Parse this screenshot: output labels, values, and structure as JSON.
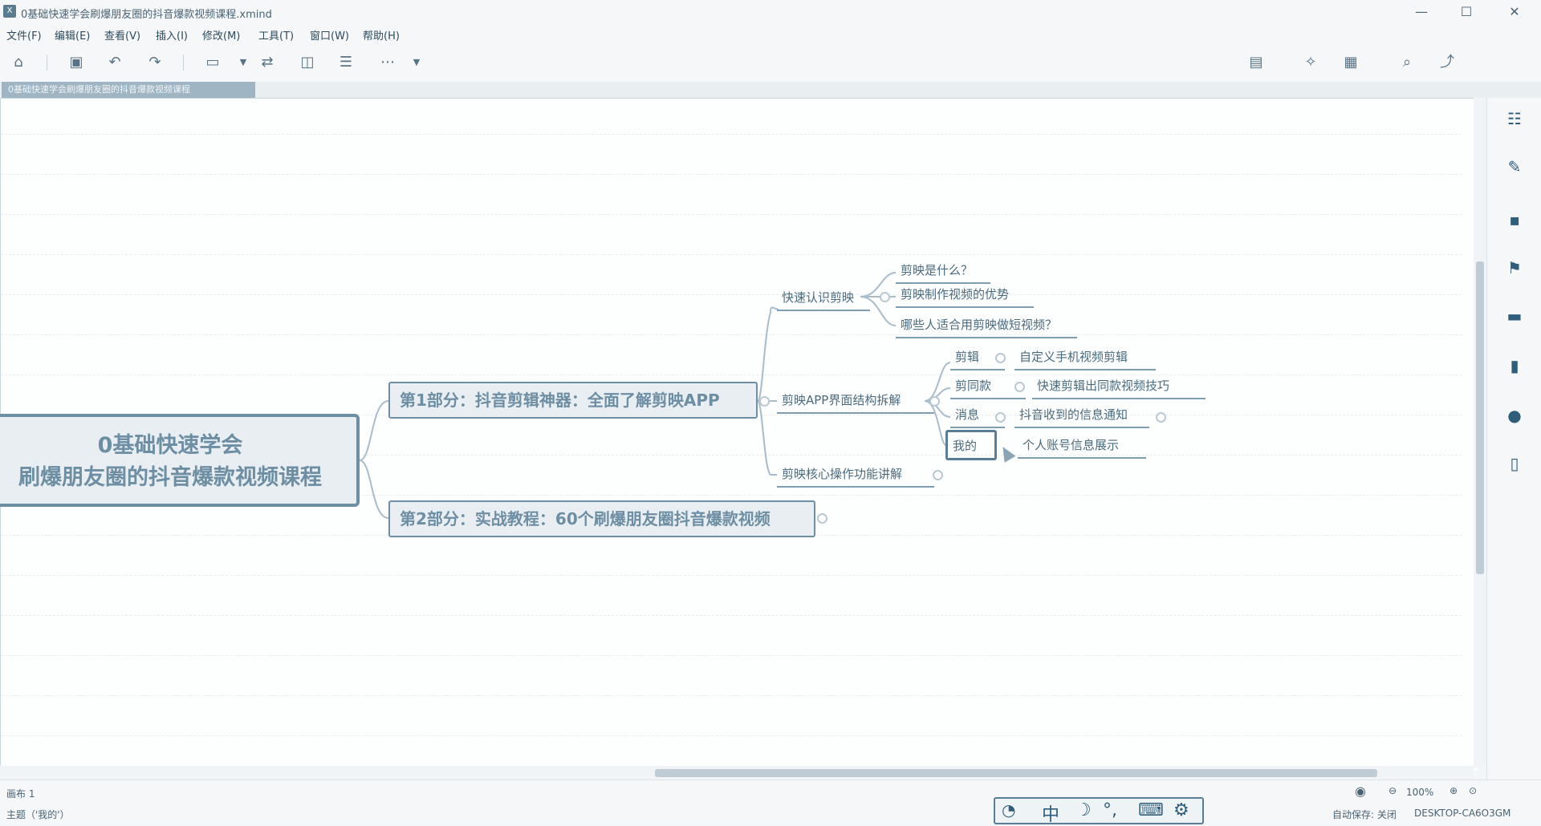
{
  "window": {
    "title": "0基础快速学会刷爆朋友圈的抖音爆款视频课程.xmind",
    "minimize": "—",
    "maximize": "☐",
    "close": "✕"
  },
  "menu": [
    "文件(F)",
    "编辑(E)",
    "查看(V)",
    "插入(I)",
    "修改(M)",
    "工具(T)",
    "窗口(W)",
    "帮助(H)"
  ],
  "toolbar": {
    "icons": [
      "home-icon",
      "save-icon",
      "undo-icon",
      "redo-icon",
      "insert-topic-icon",
      "relationship-icon",
      "boundary-icon",
      "summary-icon",
      "more-icon"
    ],
    "right_icons": [
      "presentation-icon",
      "idea-icon",
      "layout-icon",
      "search-icon",
      "share-icon"
    ]
  },
  "tab": {
    "label": "0基础快速学会刷爆朋友圈的抖音爆款视频课程"
  },
  "mindmap": {
    "root": [
      "0基础快速学会",
      "刷爆朋友圈的抖音爆款视频课程"
    ],
    "main1": "第1部分：抖音剪辑神器：全面了解剪映APP",
    "main2": "第2部分：实战教程：60个刷爆朋友圈抖音爆款视频",
    "sub_know": "快速认识剪映",
    "what_is": "剪映是什么？",
    "advantage": "剪映制作视频的优势",
    "who_fit": "哪些人适合用剪映做短视频？",
    "sub_structure": "剪映APP界面结构拆解",
    "edit": "剪辑",
    "edit_detail": "自定义手机视频剪辑",
    "same_style": "剪同款",
    "same_detail": "快速剪辑出同款视频技巧",
    "message": "消息",
    "message_detail": "抖音收到的信息通知",
    "mine": "我的",
    "mine_detail": "个人账号信息展示",
    "sub_core": "剪映核心操作功能讲解"
  },
  "bottom": {
    "sheet": "画布 1",
    "zoom": "100%"
  },
  "status": {
    "left": "主题（'我的'）",
    "autosave": "自动保存: 关闭",
    "computer": "DESKTOP-CA6O3GM"
  },
  "ime": [
    "中",
    "☽",
    "°,",
    "⌨",
    "⚙"
  ],
  "colors": {
    "accent": "#6d8ea3",
    "canvas": "#fdfefe"
  }
}
